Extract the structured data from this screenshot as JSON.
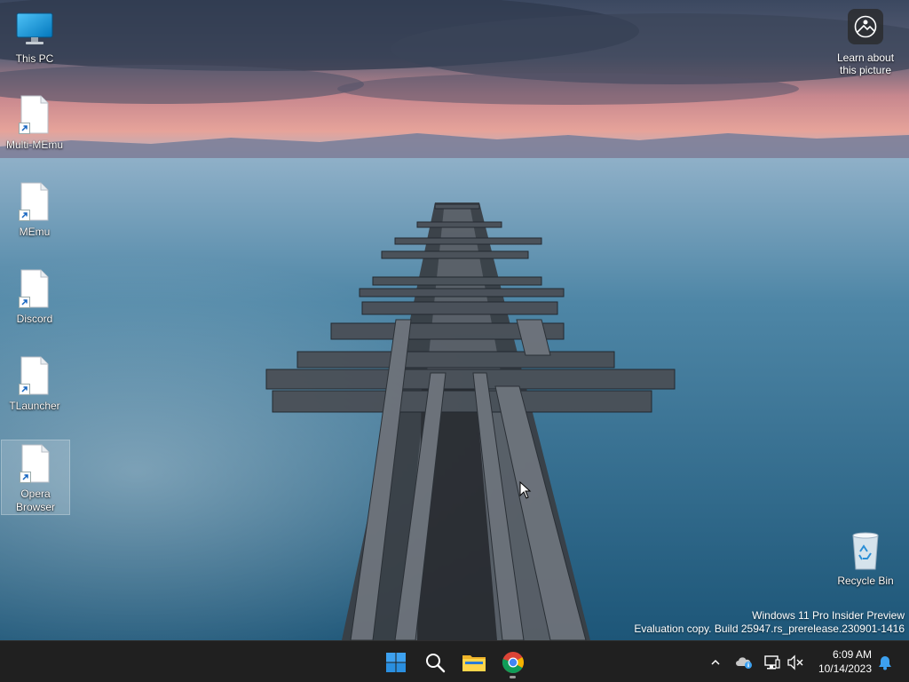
{
  "desktop": {
    "icons": [
      {
        "name": "this-pc",
        "label": "This PC"
      },
      {
        "name": "multi-memu",
        "label": "Multi-MEmu"
      },
      {
        "name": "memu",
        "label": "MEmu"
      },
      {
        "name": "discord",
        "label": "Discord"
      },
      {
        "name": "tlauncher",
        "label": "TLauncher"
      },
      {
        "name": "opera-browser",
        "label": "Opera Browser"
      }
    ],
    "recycle_bin": {
      "label": "Recycle Bin"
    },
    "learn_about": {
      "label": "Learn about this picture"
    }
  },
  "watermark": {
    "line1": "Windows 11 Pro Insider Preview",
    "line2": "Evaluation copy. Build 25947.rs_prerelease.230901-1416"
  },
  "taskbar": {
    "apps": [
      "start-icon",
      "search-icon",
      "file-explorer-icon",
      "chrome-icon"
    ],
    "clock": {
      "time": "6:09 AM",
      "date": "10/14/2023"
    }
  },
  "colors": {
    "taskbar": "#202020",
    "accent": "#0078d4"
  }
}
